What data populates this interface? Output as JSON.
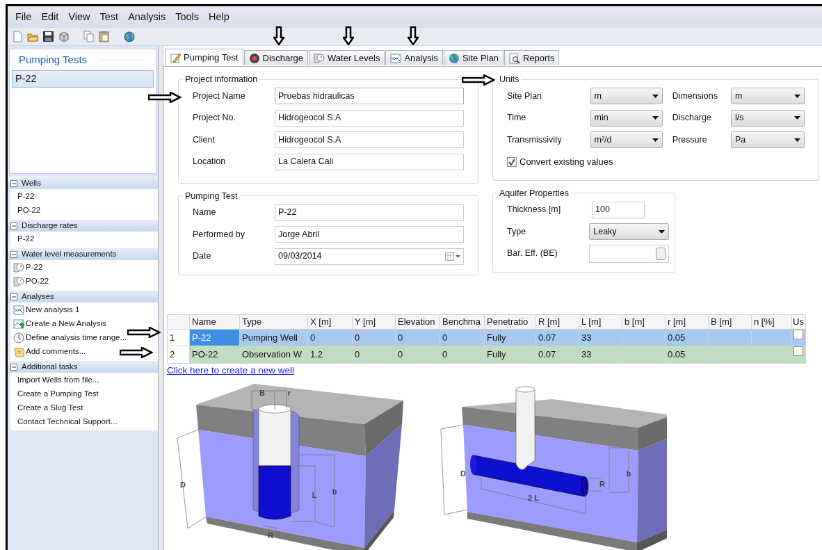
{
  "menu": [
    "File",
    "Edit",
    "View",
    "Test",
    "Analysis",
    "Tools",
    "Help"
  ],
  "sidebar": {
    "title": "Pumping Tests",
    "tests": [
      {
        "label": "P-22",
        "selected": true
      }
    ],
    "sections": [
      {
        "title": "Wells",
        "expanded": true,
        "items": [
          {
            "label": "P-22",
            "kind": "text"
          },
          {
            "label": "PO-22",
            "kind": "text"
          }
        ]
      },
      {
        "title": "Discharge rates",
        "expanded": true,
        "items": [
          {
            "label": "P-22",
            "kind": "text"
          }
        ]
      },
      {
        "title": "Water level measurements",
        "expanded": true,
        "items": [
          {
            "label": "P-22",
            "kind": "gauge"
          },
          {
            "label": "PO-22",
            "kind": "gauge"
          }
        ]
      },
      {
        "title": "Analyses",
        "expanded": true,
        "items": [
          {
            "label": "New analysis 1",
            "kind": "chart"
          },
          {
            "label": "Create a New Analysis",
            "kind": "chart-add"
          },
          {
            "label": "Define analysis time range...",
            "kind": "clock"
          },
          {
            "label": "Add comments...",
            "kind": "note-link"
          }
        ]
      },
      {
        "title": "Additional tasks",
        "expanded": true,
        "items": [
          {
            "label": "Import Wells from file...",
            "kind": "text"
          },
          {
            "label": "Create a Pumping Test",
            "kind": "text"
          },
          {
            "label": "Create a Slug Test",
            "kind": "text"
          },
          {
            "label": "Contact Technical Support...",
            "kind": "text"
          }
        ]
      }
    ]
  },
  "tabs": [
    {
      "label": "Pumping Test",
      "selected": true
    },
    {
      "label": "Discharge",
      "selected": false
    },
    {
      "label": "Water Levels",
      "selected": false
    },
    {
      "label": "Analysis",
      "selected": false
    },
    {
      "label": "Site Plan",
      "selected": false
    },
    {
      "label": "Reports",
      "selected": false
    }
  ],
  "project_information": {
    "title": "Project information",
    "fields": [
      {
        "label": "Project Name",
        "value": "Pruebas hidraulicas",
        "focused": true
      },
      {
        "label": "Project No.",
        "value": "Hidrogeocol S.A",
        "focused": false
      },
      {
        "label": "Client",
        "value": "Hidrogeocol S.A",
        "focused": false
      },
      {
        "label": "Location",
        "value": "La Calera Cali",
        "focused": false
      }
    ]
  },
  "units": {
    "title": "Units",
    "fields": [
      {
        "label": "Site Plan",
        "value": "m"
      },
      {
        "label": "Dimensions",
        "value": "m"
      },
      {
        "label": "Time",
        "value": "min"
      },
      {
        "label": "Discharge",
        "value": "l/s"
      },
      {
        "label": "Transmissivity",
        "value": "m²/d"
      },
      {
        "label": "Pressure",
        "value": "Pa"
      }
    ],
    "convert": {
      "label": "Convert existing values",
      "checked": true
    }
  },
  "pumping_test": {
    "title": "Pumping Test",
    "fields": [
      {
        "label": "Name",
        "value": "P-22",
        "kind": "text"
      },
      {
        "label": "Performed by",
        "value": "Jorge Abril",
        "kind": "text"
      },
      {
        "label": "Date",
        "value": "09/03/2014",
        "kind": "date"
      }
    ]
  },
  "aquifer_properties": {
    "title": "Aquifer Properties",
    "fields": [
      {
        "label": "Thickness [m]",
        "value": "100",
        "kind": "text"
      },
      {
        "label": "Type",
        "value": "Leaky",
        "kind": "select"
      },
      {
        "label": "Bar. Eff. (BE)",
        "kind": "button"
      }
    ]
  },
  "table": {
    "columns": [
      "",
      "Name",
      "Type",
      "X [m]",
      "Y [m]",
      "Elevation",
      "Benchma",
      "Penetratio",
      "R [m]",
      "L [m]",
      "b [m]",
      "r [m]",
      "B [m]",
      "n [%]",
      "Us"
    ],
    "rows": [
      {
        "cells": [
          "1",
          "P-22",
          "Pumping Well",
          "0",
          "0",
          "0",
          "0",
          "Fully",
          "0.07",
          "33",
          "",
          "0.05",
          "",
          ""
        ],
        "selected": true,
        "color": "#a9c9ee",
        "checked": false
      },
      {
        "cells": [
          "2",
          "PO-22",
          "Observation W",
          "1.2",
          "0",
          "0",
          "0",
          "Fully",
          "0.07",
          "33",
          "",
          "0.05",
          "",
          ""
        ],
        "selected": false,
        "color": "#c1ddc1",
        "checked": false
      }
    ]
  },
  "new_well_link": "Click here to create a new well",
  "diagrams": [
    {
      "labels": [
        "B",
        "r",
        "D",
        "L",
        "b",
        "R"
      ]
    },
    {
      "labels": [
        "D",
        "2 L",
        "R",
        "b"
      ]
    }
  ]
}
